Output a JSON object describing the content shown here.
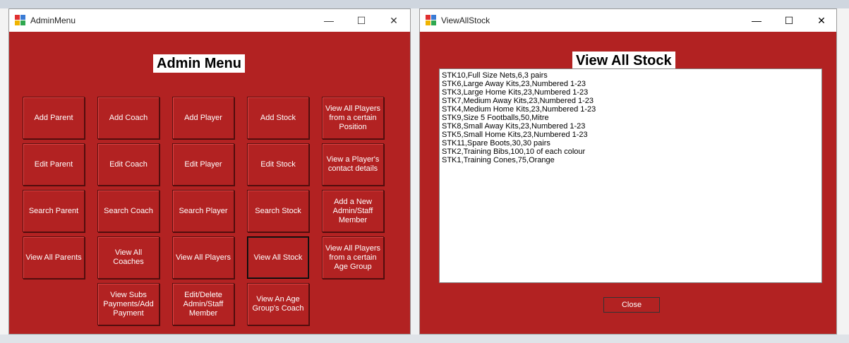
{
  "admin_menu": {
    "window_title": "AdminMenu",
    "heading": "Admin Menu",
    "buttons": [
      [
        "Add Parent",
        "Add Coach",
        "Add Player",
        "Add Stock",
        "View All Players from a certain Position"
      ],
      [
        "Edit Parent",
        "Edit Coach",
        "Edit Player",
        "Edit Stock",
        "View a Player's contact details"
      ],
      [
        "Search Parent",
        "Search Coach",
        "Search Player",
        "Search Stock",
        "Add a New Admin/Staff Member"
      ],
      [
        "View All Parents",
        "View All Coaches",
        "View All Players",
        "View All Stock",
        "View All Players from a certain Age Group"
      ],
      [
        "View Subs Payments/Add Payment",
        "Edit/Delete Admin/Staff Member",
        "View An Age Group's Coach"
      ]
    ]
  },
  "view_all_stock": {
    "window_title": "ViewAllStock",
    "heading": "View All Stock",
    "stock_lines": [
      "STK10,Full Size Nets,6,3 pairs",
      "STK6,Large Away Kits,23,Numbered 1-23",
      "STK3,Large Home Kits,23,Numbered 1-23",
      "STK7,Medium Away Kits,23,Numbered 1-23",
      "STK4,Medium Home Kits,23,Numbered 1-23",
      "STK9,Size 5 Footballs,50,Mitre",
      "STK8,Small Away Kits,23,Numbered 1-23",
      "STK5,Small Home Kits,23,Numbered 1-23",
      "STK11,Spare Boots,30,30 pairs",
      "STK2,Training Bibs,100,10 of each colour",
      "STK1,Training Cones,75,Orange"
    ],
    "close_label": "Close"
  },
  "window_controls": {
    "minimize": "—",
    "maximize": "☐",
    "close": "✕"
  },
  "colors": {
    "form_bg": "#b22222",
    "titlebar": "#ffffff"
  }
}
